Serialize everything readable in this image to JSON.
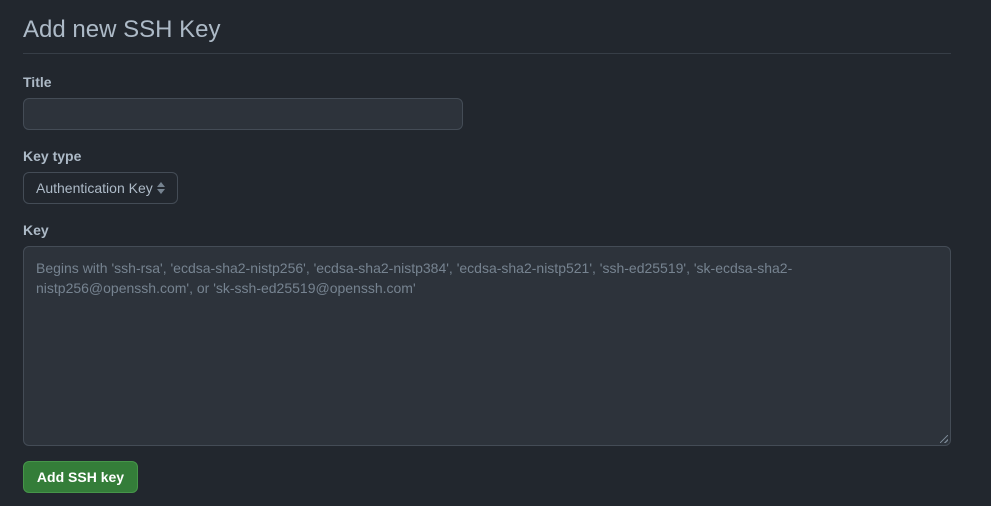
{
  "page": {
    "title": "Add new SSH Key"
  },
  "form": {
    "title_field": {
      "label": "Title",
      "value": ""
    },
    "key_type": {
      "label": "Key type",
      "selected": "Authentication Key"
    },
    "key_field": {
      "label": "Key",
      "placeholder": "Begins with 'ssh-rsa', 'ecdsa-sha2-nistp256', 'ecdsa-sha2-nistp384', 'ecdsa-sha2-nistp521', 'ssh-ed25519', 'sk-ecdsa-sha2-nistp256@openssh.com', or 'sk-ssh-ed25519@openssh.com'"
    },
    "submit_label": "Add SSH key"
  },
  "colors": {
    "background": "#22272e",
    "input_background": "#2d333b",
    "border": "#444c56",
    "primary_button": "#347d39",
    "text": "#adbac7",
    "muted_text": "#768390"
  },
  "icons": {
    "select_arrows": "chevron-up-down-icon",
    "resize_handle": "resize-grip-icon"
  }
}
